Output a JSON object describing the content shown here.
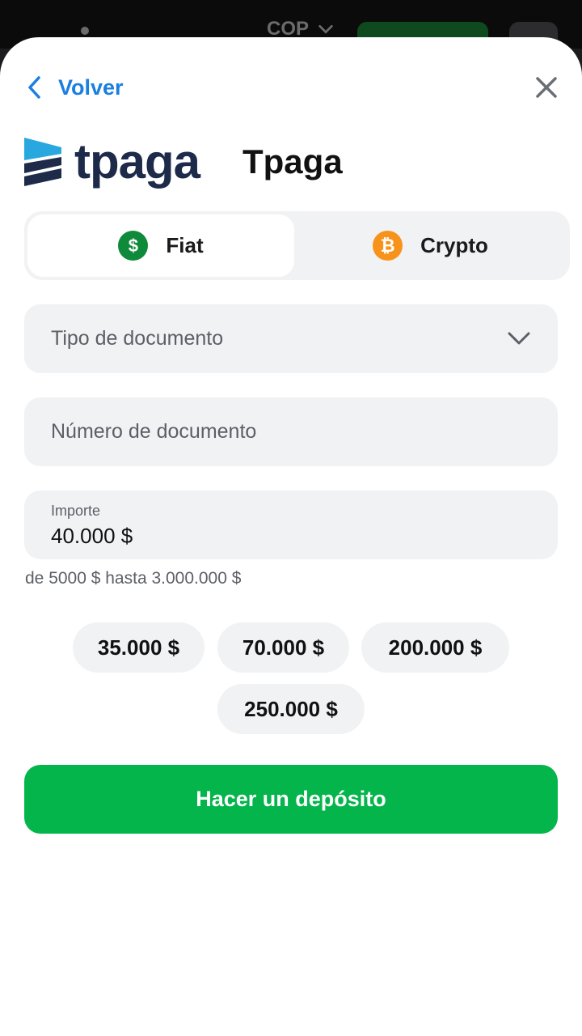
{
  "background": {
    "currency": "COP"
  },
  "header": {
    "back_label": "Volver"
  },
  "brand": {
    "logo_text": "tpaga",
    "provider_name": "Tpaga"
  },
  "tabs": [
    {
      "label": "Fiat",
      "icon": "dollar-coin-icon",
      "active": true
    },
    {
      "label": "Crypto",
      "icon": "bitcoin-icon",
      "active": false
    }
  ],
  "form": {
    "document_type_placeholder": "Tipo de documento",
    "document_number_placeholder": "Número de documento",
    "amount_label": "Importe",
    "amount_value": "40.000 $",
    "range_hint": "de 5000 $ hasta 3.000.000 $"
  },
  "quick_amounts": [
    "35.000 $",
    "70.000 $",
    "200.000 $",
    "250.000 $"
  ],
  "cta_label": "Hacer un depósito",
  "colors": {
    "accent_blue": "#1a7fe0",
    "cta_green": "#04b54c",
    "fiat_green": "#0f8a3a",
    "crypto_orange": "#f7931a",
    "brand_navy": "#1d2a4a"
  }
}
